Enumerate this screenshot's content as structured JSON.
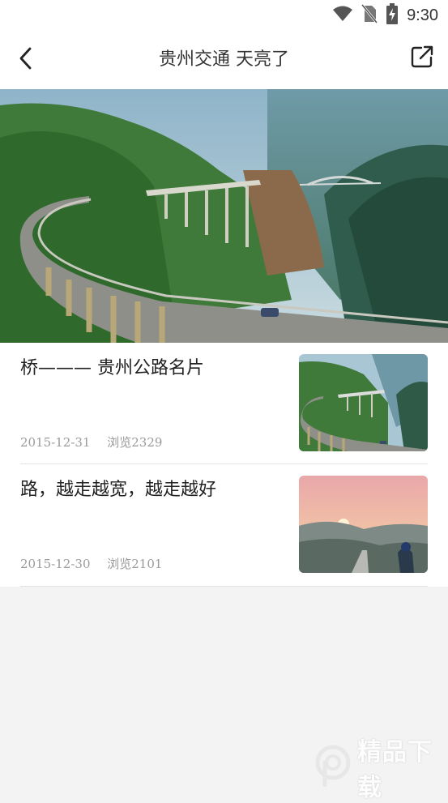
{
  "status_bar": {
    "time": "9:30",
    "icons": [
      "wifi-icon",
      "no-sim-icon",
      "battery-charging-icon"
    ]
  },
  "header": {
    "title": "贵州交通 天亮了",
    "back_icon": "chevron-left-icon",
    "share_icon": "share-external-icon"
  },
  "articles": [
    {
      "title": "桥——— 贵州公路名片",
      "date": "2015-12-31",
      "views": "浏览2329",
      "thumbnail": "highway-bridge-thumbnail"
    },
    {
      "title": "路，越走越宽，越走越好",
      "date": "2015-12-30",
      "views": "浏览2101",
      "thumbnail": "sunset-highway-thumbnail"
    }
  ],
  "watermark": {
    "text": "精品下载"
  },
  "colors": {
    "background": "#f3f3f3",
    "card": "#ffffff",
    "meta_text": "#9a9a9a",
    "divider": "#e2e2e2"
  }
}
